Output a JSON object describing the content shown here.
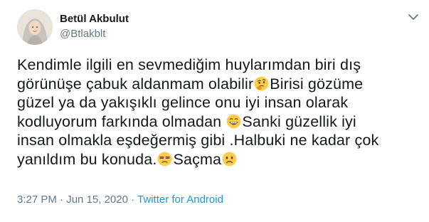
{
  "user": {
    "display_name": "Betül Akbulut",
    "handle": "@Btlakblt",
    "avatar_icon": "avatar-photo"
  },
  "tweet": {
    "lines": [
      "Kendimle ilgili en sevmediğim huylarımdan biri dış",
      "görünüşe çabuk aldanmam olabilir",
      "Birisi gözüme",
      "güzel ya da yakışıklı gelince onu iyi insan olarak",
      "kodluyorum farkında olmadan ",
      "Sanki güzellik iyi",
      "insan olmakla eşdeğermiş gibi .Halbuki ne kadar çok",
      "yanıldım bu konuda.",
      "Saçma"
    ],
    "emojis": [
      "thinking-face-icon",
      "grinning-face-icon",
      "unamused-face-icon",
      "frowning-face-icon"
    ]
  },
  "meta": {
    "time": "3:27 PM",
    "separator_1": " · ",
    "date": "Jun 15, 2020",
    "separator_2": " · ",
    "source": "Twitter for Android"
  },
  "colors": {
    "text": "#14171a",
    "secondary": "#657786",
    "link": "#1b95e0",
    "emoji_yellow": "#ffcc4d"
  }
}
